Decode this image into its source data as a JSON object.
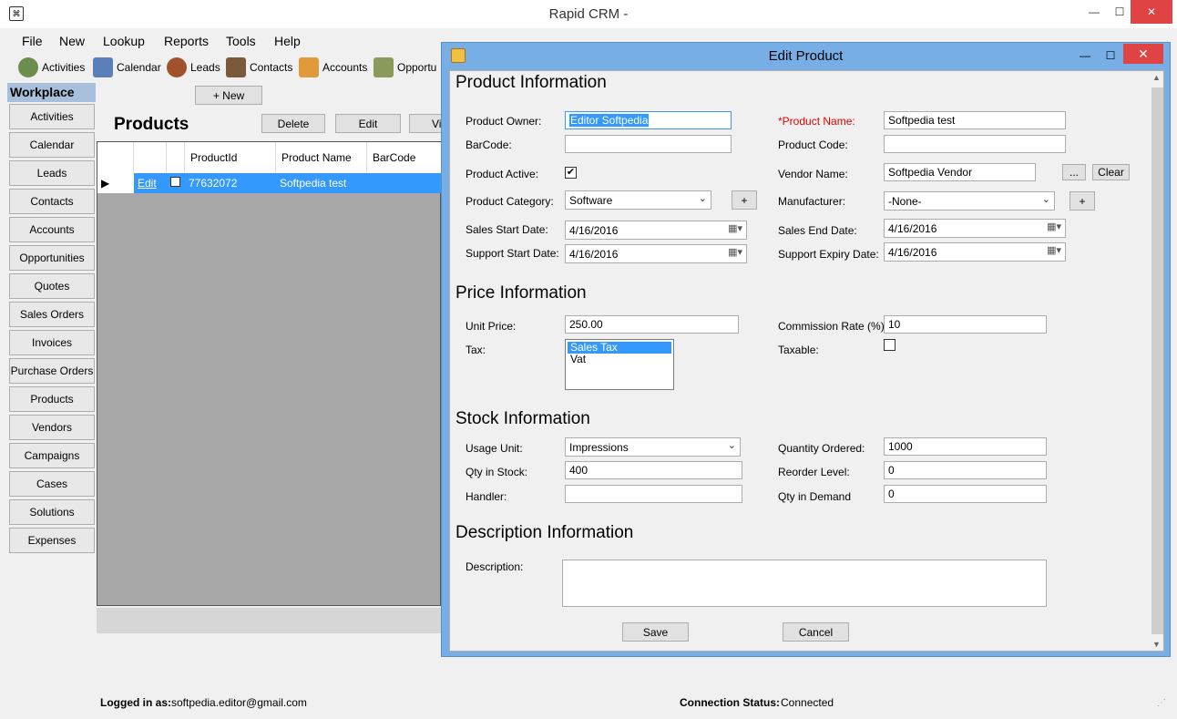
{
  "app": {
    "title": "Rapid CRM -",
    "window_controls": {
      "minimize": "—",
      "maximize": "☐",
      "close": "✕"
    }
  },
  "menu": [
    "File",
    "New",
    "Lookup",
    "Reports",
    "Tools",
    "Help"
  ],
  "toolbar": [
    "Activities",
    "Calendar",
    "Leads",
    "Contacts",
    "Accounts",
    "Opportu"
  ],
  "sidebar": {
    "header": "Workplace",
    "items": [
      "Activities",
      "Calendar",
      "Leads",
      "Contacts",
      "Accounts",
      "Opportunities",
      "Quotes",
      "Sales Orders",
      "Invoices",
      "Purchase Orders",
      "Products",
      "Vendors",
      "Campaigns",
      "Cases",
      "Solutions",
      "Expenses"
    ]
  },
  "products": {
    "new_button": "+ New",
    "title": "Products",
    "delete_button": "Delete",
    "edit_button": "Edit",
    "view_button": "Vi",
    "columns": [
      "ProductId",
      "Product Name",
      "BarCode"
    ],
    "row": {
      "edit_link": "Edit",
      "product_id": "77632072",
      "product_name": "Softpedia test",
      "barcode": ""
    }
  },
  "status": {
    "logged_in_label": "Logged in as:",
    "logged_in_value": "softpedia.editor@gmail.com",
    "connection_label": "Connection Status:",
    "connection_value": "Connected"
  },
  "dialog": {
    "title": "Edit Product",
    "product_info": {
      "heading": "Product Information",
      "owner_label": "Product Owner:",
      "owner_value": "Editor Softpedia",
      "name_label": "*Product Name:",
      "name_value": "Softpedia test",
      "barcode_label": "BarCode:",
      "barcode_value": "",
      "code_label": "Product Code:",
      "code_value": "",
      "active_label": "Product Active:",
      "active_checked": true,
      "vendor_label": "Vendor Name:",
      "vendor_value": "Softpedia Vendor",
      "vendor_browse": "...",
      "vendor_clear": "Clear",
      "category_label": "Product Category:",
      "category_value": "Software",
      "add_symbol": "+",
      "manufacturer_label": "Manufacturer:",
      "manufacturer_value": "-None-",
      "sales_start_label": "Sales Start Date:",
      "sales_start_value": "4/16/2016",
      "sales_end_label": "Sales End Date:",
      "sales_end_value": "4/16/2016",
      "support_start_label": "Support Start Date:",
      "support_start_value": "4/16/2016",
      "support_expiry_label": "Support Expiry Date:",
      "support_expiry_value": "4/16/2016"
    },
    "price_info": {
      "heading": "Price Information",
      "unit_price_label": "Unit Price:",
      "unit_price_value": "250.00",
      "commission_label": "Commission Rate (%):",
      "commission_value": "10",
      "tax_label": "Tax:",
      "tax_options": [
        "Sales Tax",
        "Vat"
      ],
      "tax_selected": "Sales Tax",
      "taxable_label": "Taxable:",
      "taxable_checked": false
    },
    "stock_info": {
      "heading": "Stock Information",
      "usage_unit_label": "Usage Unit:",
      "usage_unit_value": "Impressions",
      "qty_ordered_label": "Quantity Ordered:",
      "qty_ordered_value": "1000",
      "qty_stock_label": "Qty in Stock:",
      "qty_stock_value": "400",
      "reorder_label": "Reorder Level:",
      "reorder_value": "0",
      "handler_label": "Handler:",
      "handler_value": "",
      "qty_demand_label": "Qty in Demand",
      "qty_demand_value": "0"
    },
    "description_info": {
      "heading": "Description Information",
      "description_label": "Description:",
      "description_value": ""
    },
    "save_button": "Save",
    "cancel_button": "Cancel"
  }
}
